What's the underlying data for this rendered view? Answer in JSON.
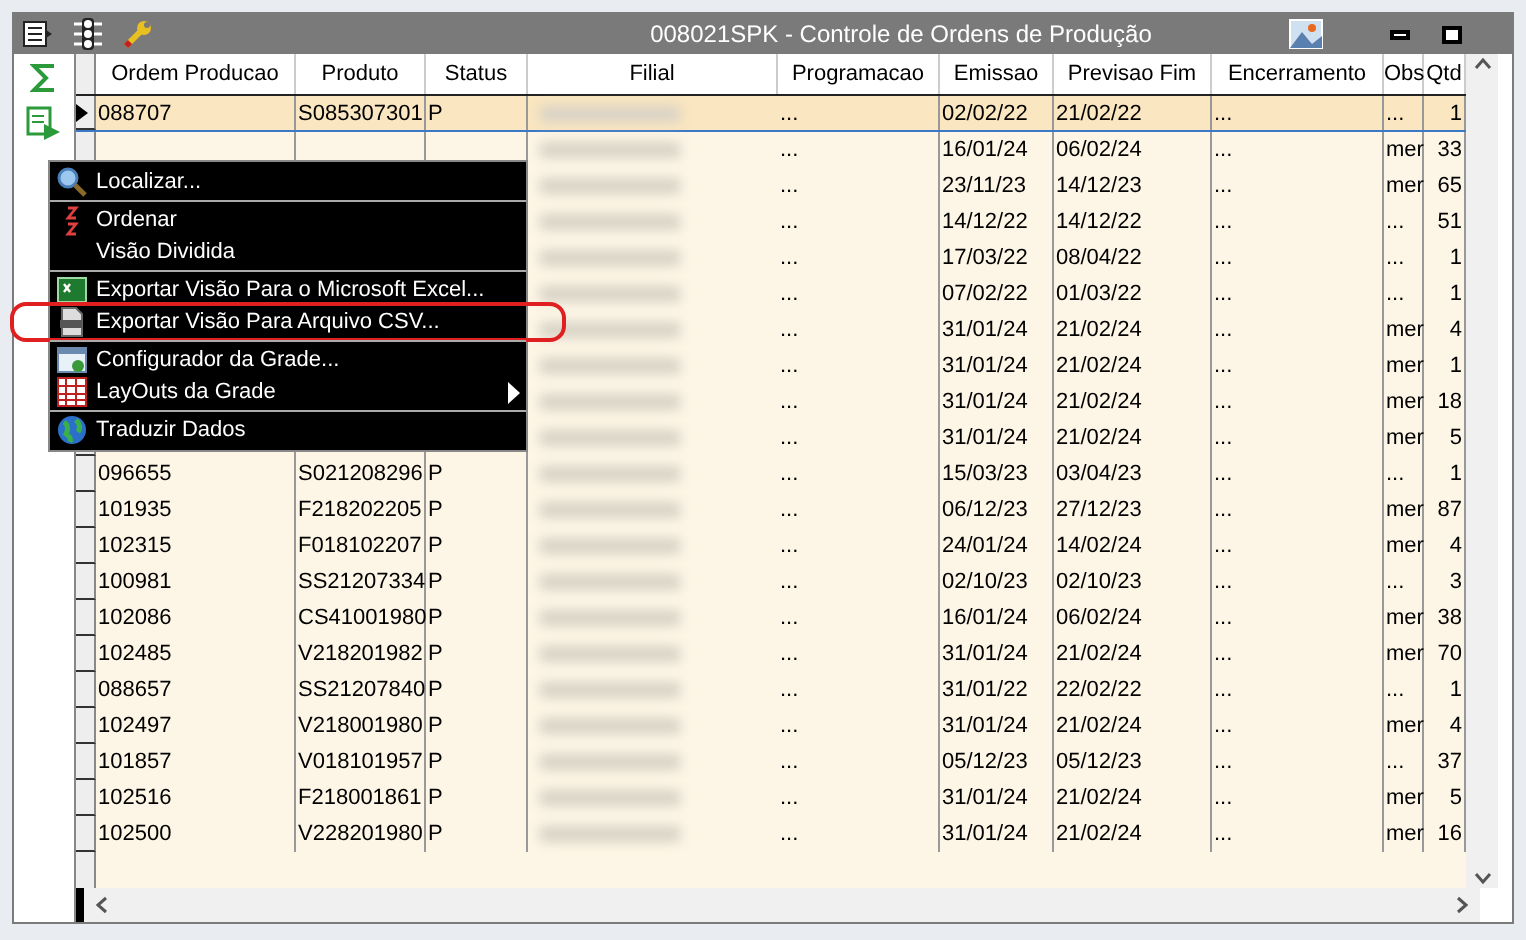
{
  "window": {
    "title": "008021SPK - Controle de Ordens de Produção"
  },
  "columns": [
    {
      "label": "Ordem Producao",
      "kind": "text"
    },
    {
      "label": "Produto",
      "kind": "text"
    },
    {
      "label": "Status",
      "kind": "text"
    },
    {
      "label": "Filial",
      "kind": "redacted"
    },
    {
      "label": "Programacao",
      "kind": "text"
    },
    {
      "label": "Emissao",
      "kind": "text"
    },
    {
      "label": "Previsao Fim",
      "kind": "text"
    },
    {
      "label": "Encerramento",
      "kind": "text"
    },
    {
      "label": "Obs",
      "kind": "text"
    },
    {
      "label": "Qtd",
      "kind": "number"
    }
  ],
  "rows": [
    {
      "selected": true,
      "cells": [
        "088707",
        "S085307301",
        "P",
        null,
        "...",
        "02/02/22",
        "21/02/22",
        "...",
        "...",
        "1"
      ]
    },
    {
      "selected": false,
      "cells": [
        null,
        null,
        null,
        null,
        "...",
        "16/01/24",
        "06/02/24",
        "...",
        "mer",
        "33"
      ]
    },
    {
      "selected": false,
      "cells": [
        null,
        null,
        null,
        null,
        "...",
        "23/11/23",
        "14/12/23",
        "...",
        "mer",
        "65"
      ]
    },
    {
      "selected": false,
      "cells": [
        null,
        null,
        null,
        null,
        "...",
        "14/12/22",
        "14/12/22",
        "...",
        "...",
        "51"
      ]
    },
    {
      "selected": false,
      "cells": [
        null,
        null,
        null,
        null,
        "...",
        "17/03/22",
        "08/04/22",
        "...",
        "...",
        "1"
      ]
    },
    {
      "selected": false,
      "cells": [
        null,
        null,
        null,
        null,
        "...",
        "07/02/22",
        "01/03/22",
        "...",
        "...",
        "1"
      ]
    },
    {
      "selected": false,
      "cells": [
        null,
        null,
        null,
        null,
        "...",
        "31/01/24",
        "21/02/24",
        "...",
        "mer",
        "4"
      ]
    },
    {
      "selected": false,
      "cells": [
        null,
        null,
        null,
        null,
        "...",
        "31/01/24",
        "21/02/24",
        "...",
        "mer",
        "1"
      ]
    },
    {
      "selected": false,
      "cells": [
        null,
        null,
        null,
        null,
        "...",
        "31/01/24",
        "21/02/24",
        "...",
        "mer",
        "18"
      ]
    },
    {
      "selected": false,
      "cells": [
        null,
        null,
        null,
        null,
        "...",
        "31/01/24",
        "21/02/24",
        "...",
        "mer",
        "5"
      ]
    },
    {
      "selected": false,
      "cells": [
        "096655",
        "S021208296",
        "P",
        null,
        "...",
        "15/03/23",
        "03/04/23",
        "...",
        "...",
        "1"
      ]
    },
    {
      "selected": false,
      "cells": [
        "101935",
        "F218202205",
        "P",
        null,
        "...",
        "06/12/23",
        "27/12/23",
        "...",
        "mer",
        "87"
      ]
    },
    {
      "selected": false,
      "cells": [
        "102315",
        "F018102207",
        "P",
        null,
        "...",
        "24/01/24",
        "14/02/24",
        "...",
        "mer",
        "4"
      ]
    },
    {
      "selected": false,
      "cells": [
        "100981",
        "SS21207334",
        "P",
        null,
        "...",
        "02/10/23",
        "02/10/23",
        "...",
        "...",
        "3"
      ]
    },
    {
      "selected": false,
      "cells": [
        "102086",
        "CS41001980",
        "P",
        null,
        "...",
        "16/01/24",
        "06/02/24",
        "...",
        "mer",
        "38"
      ]
    },
    {
      "selected": false,
      "cells": [
        "102485",
        "V218201982",
        "P",
        null,
        "...",
        "31/01/24",
        "21/02/24",
        "...",
        "mer",
        "70"
      ]
    },
    {
      "selected": false,
      "cells": [
        "088657",
        "SS21207840",
        "P",
        null,
        "...",
        "31/01/22",
        "22/02/22",
        "...",
        "...",
        "1"
      ]
    },
    {
      "selected": false,
      "cells": [
        "102497",
        "V218001980",
        "P",
        null,
        "...",
        "31/01/24",
        "21/02/24",
        "...",
        "mer",
        "4"
      ]
    },
    {
      "selected": false,
      "cells": [
        "101857",
        "V018101957",
        "P",
        null,
        "...",
        "05/12/23",
        "05/12/23",
        "...",
        "...",
        "37"
      ]
    },
    {
      "selected": false,
      "cells": [
        "102516",
        "F218001861",
        "P",
        null,
        "...",
        "31/01/24",
        "21/02/24",
        "...",
        "mer",
        "5"
      ]
    },
    {
      "selected": false,
      "cells": [
        "102500",
        "V228201980",
        "P",
        null,
        "...",
        "31/01/24",
        "21/02/24",
        "...",
        "mer",
        "16"
      ]
    }
  ],
  "context_menu": {
    "groups": [
      [
        {
          "label": "Localizar...",
          "highlighted": false,
          "submenu": false
        }
      ],
      [
        {
          "label": "Ordenar",
          "highlighted": false,
          "submenu": false
        },
        {
          "label": "Visão Dividida",
          "highlighted": false,
          "submenu": false
        }
      ],
      [
        {
          "label": "Exportar Visão Para o Microsoft Excel...",
          "highlighted": false,
          "submenu": false
        },
        {
          "label": "Exportar Visão Para Arquivo CSV...",
          "highlighted": true,
          "submenu": false
        }
      ],
      [
        {
          "label": "Configurador da Grade...",
          "highlighted": false,
          "submenu": false
        },
        {
          "label": "LayOuts da Grade",
          "highlighted": false,
          "submenu": true
        }
      ],
      [
        {
          "label": "Traduzir Dados",
          "highlighted": false,
          "submenu": false
        }
      ]
    ]
  }
}
